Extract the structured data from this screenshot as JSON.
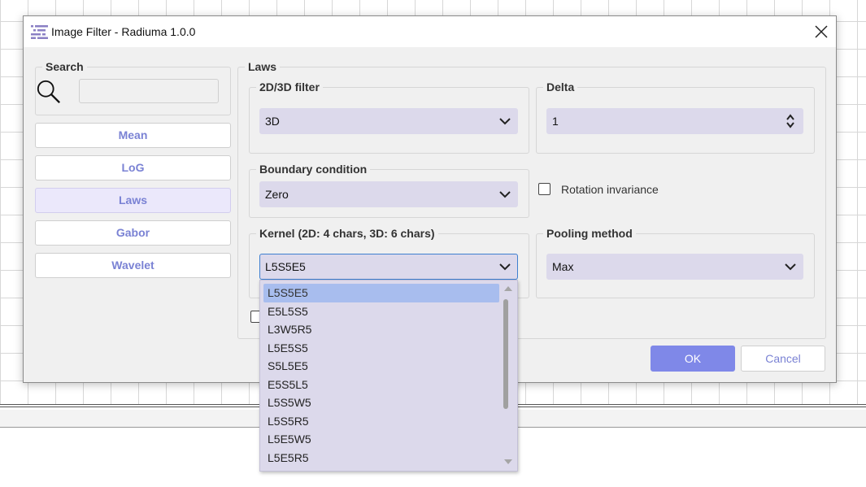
{
  "window": {
    "title": "Image Filter - Radiuma 1.0.0",
    "close_label": "✕"
  },
  "search": {
    "group_title": "Search",
    "value": "",
    "placeholder": ""
  },
  "filters": {
    "items": [
      {
        "label": "Mean"
      },
      {
        "label": "LoG"
      },
      {
        "label": "Laws"
      },
      {
        "label": "Gabor"
      },
      {
        "label": "Wavelet"
      }
    ],
    "active": "Laws"
  },
  "laws": {
    "group_title": "Laws",
    "filter_dim": {
      "title": "2D/3D filter",
      "value": "3D"
    },
    "delta": {
      "title": "Delta",
      "value": "1"
    },
    "boundary": {
      "title": "Boundary condition",
      "value": "Zero"
    },
    "rotation_invariance": {
      "label": "Rotation invariance",
      "checked": false
    },
    "kernel": {
      "title": "Kernel (2D: 4 chars, 3D: 6 chars)",
      "value": "L5S5E5",
      "options": [
        "L5S5E5",
        "E5L5S5",
        "L3W5R5",
        "L5E5S5",
        "S5L5E5",
        "E5S5L5",
        "L5S5W5",
        "L5S5R5",
        "L5E5W5",
        "L5E5R5"
      ]
    },
    "pooling": {
      "title": "Pooling method",
      "value": "Max"
    }
  },
  "actions": {
    "ok_label": "OK",
    "cancel_label": "Cancel"
  },
  "colors": {
    "accent": "#7f88e8",
    "combo_bg": "#dcd9eb",
    "selected_item": "#a8bdee",
    "button_text": "#7a82d4"
  }
}
